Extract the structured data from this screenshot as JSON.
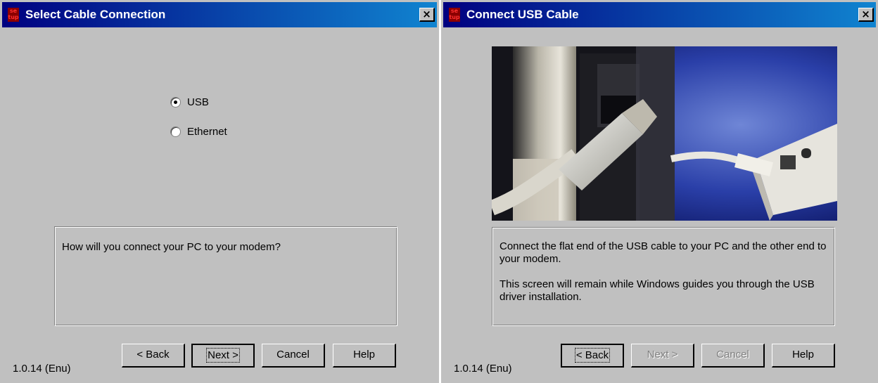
{
  "left_window": {
    "title": "Select Cable Connection",
    "options": [
      {
        "label": "USB",
        "checked": true
      },
      {
        "label": "Ethernet",
        "checked": false
      }
    ],
    "prompt": "How will you connect your PC to your modem?",
    "buttons": {
      "back": "< Back",
      "next": "Next >",
      "cancel": "Cancel",
      "help": "Help"
    },
    "version": "1.0.14 (Enu)"
  },
  "right_window": {
    "title": "Connect USB Cable",
    "message_1": "Connect the flat end of the USB cable to your PC and the other end to your modem.",
    "message_2": "This screen will remain while Windows guides you through the USB driver installation.",
    "buttons": {
      "back": "< Back",
      "next": "Next >",
      "cancel": "Cancel",
      "help": "Help"
    },
    "version": "1.0.14 (Enu)"
  },
  "icons": {
    "setup": "setup-icon",
    "close": "close-icon"
  },
  "colors": {
    "titlebar_start": "#000080",
    "titlebar_end": "#1084d0",
    "face": "#c0c0c0"
  }
}
